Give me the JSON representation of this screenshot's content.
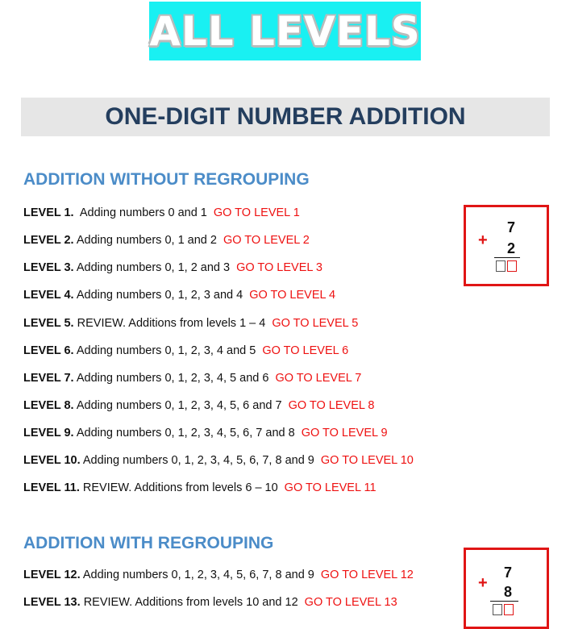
{
  "banner": {
    "text": "ALL LEVELS"
  },
  "title": "ONE-DIGIT NUMBER ADDITION",
  "sections": [
    {
      "heading": "ADDITION WITHOUT REGROUPING",
      "levels": [
        {
          "num": "LEVEL 1.",
          "desc": "Adding numbers 0 and 1",
          "link": "GO TO LEVEL 1"
        },
        {
          "num": "LEVEL 2.",
          "desc": "Adding numbers 0, 1 and 2",
          "link": "GO TO LEVEL 2"
        },
        {
          "num": "LEVEL 3.",
          "desc": "Adding numbers 0, 1, 2 and 3",
          "link": "GO TO LEVEL 3"
        },
        {
          "num": "LEVEL 4.",
          "desc": "Adding numbers 0, 1, 2, 3 and 4",
          "link": "GO TO LEVEL 4"
        },
        {
          "num": "LEVEL 5.",
          "desc": "REVIEW. Additions from levels 1 – 4",
          "link": "GO TO LEVEL 5"
        },
        {
          "num": "LEVEL 6.",
          "desc": "Adding numbers 0, 1, 2, 3, 4 and 5",
          "link": "GO TO LEVEL 6"
        },
        {
          "num": "LEVEL 7.",
          "desc": "Adding numbers 0, 1, 2, 3, 4, 5 and 6",
          "link": "GO TO LEVEL 7"
        },
        {
          "num": "LEVEL 8.",
          "desc": "Adding numbers 0, 1, 2, 3, 4, 5, 6 and 7",
          "link": "GO TO LEVEL 8"
        },
        {
          "num": "LEVEL 9.",
          "desc": "Adding numbers 0, 1, 2, 3, 4, 5, 6, 7 and 8",
          "link": "GO TO LEVEL 9"
        },
        {
          "num": "LEVEL 10.",
          "desc": "Adding numbers 0, 1, 2, 3, 4, 5, 6, 7, 8 and 9",
          "link": "GO TO LEVEL 10"
        },
        {
          "num": "LEVEL 11.",
          "desc": "REVIEW. Additions from levels 6 – 10",
          "link": "GO TO LEVEL 11"
        }
      ],
      "example": {
        "operator": "+",
        "top": "7",
        "bottom": "2"
      }
    },
    {
      "heading": "ADDITION WITH REGROUPING",
      "levels": [
        {
          "num": "LEVEL 12.",
          "desc": "Adding numbers 0, 1, 2, 3, 4, 5, 6, 7, 8 and 9",
          "link": "GO TO LEVEL 12"
        },
        {
          "num": "LEVEL 13.",
          "desc": "REVIEW. Additions from levels 10 and 12",
          "link": "GO TO LEVEL 13"
        }
      ],
      "example": {
        "operator": "+",
        "top": "7",
        "bottom": "8"
      }
    }
  ]
}
